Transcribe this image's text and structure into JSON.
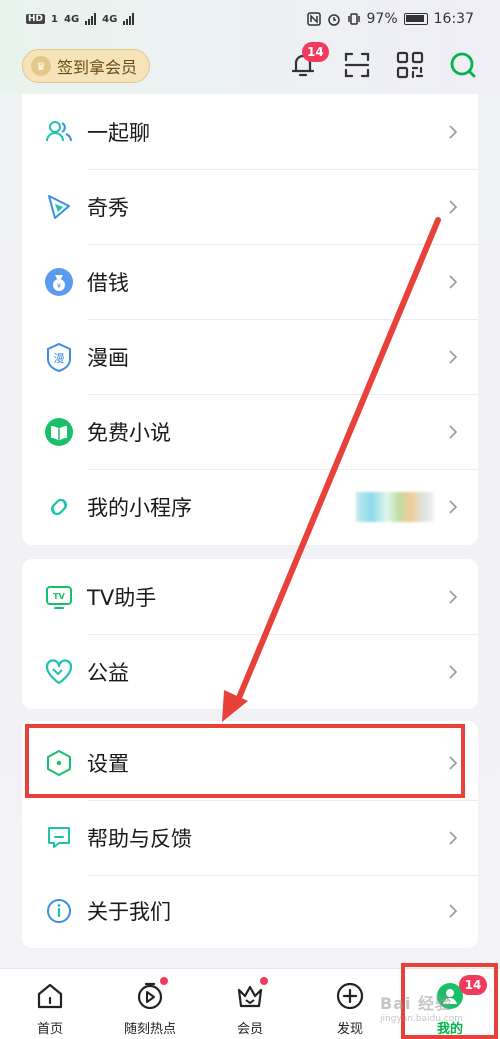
{
  "status_bar": {
    "left_badge": "HD",
    "sim1": "1",
    "net1": "4G",
    "net2": "4G",
    "battery": "97%",
    "time": "16:37"
  },
  "header": {
    "vip_sign_label": "签到拿会员",
    "notification_count": "14",
    "icons": [
      "bell-icon",
      "scan-icon",
      "qr-code-icon",
      "search-icon"
    ]
  },
  "menu_groups": [
    {
      "items": [
        {
          "label": "一起聊",
          "icon": "chat-people-icon"
        },
        {
          "label": "奇秀",
          "icon": "qixiu-icon"
        },
        {
          "label": "借钱",
          "icon": "money-bag-icon"
        },
        {
          "label": "漫画",
          "icon": "comic-icon"
        },
        {
          "label": "免费小说",
          "icon": "book-icon"
        },
        {
          "label": "我的小程序",
          "icon": "mini-program-icon"
        }
      ]
    },
    {
      "items": [
        {
          "label": "TV助手",
          "icon": "tv-icon"
        },
        {
          "label": "公益",
          "icon": "heart-icon"
        }
      ]
    },
    {
      "items": [
        {
          "label": "设置",
          "icon": "settings-hex-icon"
        },
        {
          "label": "帮助与反馈",
          "icon": "feedback-icon"
        },
        {
          "label": "关于我们",
          "icon": "info-icon"
        }
      ]
    }
  ],
  "bottom_nav": {
    "items": [
      {
        "label": "首页",
        "icon": "home-icon"
      },
      {
        "label": "随刻热点",
        "icon": "play-clock-icon"
      },
      {
        "label": "会员",
        "icon": "crown-icon"
      },
      {
        "label": "发现",
        "icon": "plus-circle-icon"
      },
      {
        "label": "我的",
        "icon": "profile-icon"
      }
    ],
    "mine_badge": "14"
  },
  "watermark": {
    "main": "Bai 经验",
    "sub": "jingyan.baidu.com"
  },
  "colors": {
    "accent_green": "#00b44a",
    "annotation_red": "#e8413a",
    "badge_red": "#f23b5c",
    "vip_gold": "#f6e3b9"
  }
}
